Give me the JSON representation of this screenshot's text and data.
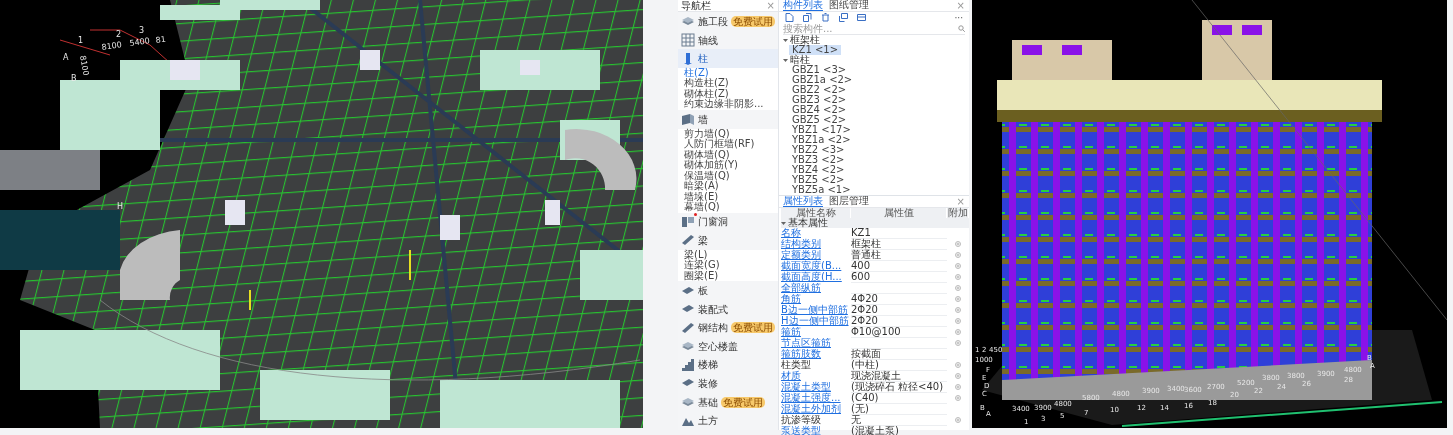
{
  "left_view": {
    "labels": [
      "1",
      "2",
      "3",
      "8100",
      "5400",
      "81",
      "A",
      "B",
      "8100",
      "H"
    ]
  },
  "navigation": {
    "title": "导航栏",
    "close": "×",
    "items": [
      {
        "label": "施工段",
        "kind": "layers",
        "badge": "免费试用",
        "selected": false
      },
      {
        "label": "轴线",
        "kind": "grid",
        "selected": false
      },
      {
        "label": "柱",
        "kind": "column",
        "selected": true,
        "children": [
          {
            "label": "柱(Z)",
            "selected": true
          },
          {
            "label": "构造柱(Z)",
            "selected": false
          },
          {
            "label": "砌体柱(Z)",
            "selected": false
          },
          {
            "label": "约束边缘非阴影...",
            "selected": false
          }
        ]
      },
      {
        "label": "墙",
        "kind": "wall",
        "selected": false,
        "children": [
          {
            "label": "剪力墙(Q)",
            "selected": false
          },
          {
            "label": "人防门框墙(RF)",
            "selected": false
          },
          {
            "label": "砌体墙(Q)",
            "selected": false
          },
          {
            "label": "砌体加筋(Y)",
            "selected": false
          },
          {
            "label": "保温墙(Q)",
            "selected": false
          },
          {
            "label": "暗梁(A)",
            "selected": false
          },
          {
            "label": "墙垛(E)",
            "selected": false
          },
          {
            "label": "幕墙(Q)",
            "selected": false
          }
        ]
      },
      {
        "label": "门窗洞",
        "kind": "door",
        "notification_dot": true,
        "selected": false
      },
      {
        "label": "梁",
        "kind": "beam",
        "selected": false,
        "children": [
          {
            "label": "梁(L)",
            "selected": false
          },
          {
            "label": "连梁(G)",
            "selected": false
          },
          {
            "label": "圈梁(E)",
            "selected": false
          }
        ]
      },
      {
        "label": "板",
        "kind": "slab",
        "selected": false
      },
      {
        "label": "装配式",
        "kind": "slab",
        "selected": false
      },
      {
        "label": "钢结构",
        "kind": "beam",
        "badge": "免费试用",
        "selected": false
      },
      {
        "label": "空心楼盖",
        "kind": "layers",
        "selected": false
      },
      {
        "label": "楼梯",
        "kind": "stairs",
        "selected": false
      },
      {
        "label": "装修",
        "kind": "slab",
        "selected": false
      },
      {
        "label": "基础",
        "kind": "layers",
        "badge": "免费试用",
        "selected": false
      },
      {
        "label": "土方",
        "kind": "earth",
        "selected": false
      }
    ]
  },
  "component_list": {
    "tabs": [
      {
        "label": "构件列表",
        "selected": true
      },
      {
        "label": "图纸管理",
        "selected": false
      }
    ],
    "close": "×",
    "more": "···",
    "search": {
      "placeholder": "搜索构件..."
    },
    "tree": [
      {
        "label": "框架柱",
        "expanded": true,
        "children": [
          {
            "label": "KZ1 <1>",
            "selected": true
          }
        ]
      },
      {
        "label": "暗柱",
        "expanded": true,
        "children": [
          {
            "label": "GBZ1 <3>",
            "selected": false
          },
          {
            "label": "GBZ1a <2>",
            "selected": false
          },
          {
            "label": "GBZ2 <2>",
            "selected": false
          },
          {
            "label": "GBZ3 <2>",
            "selected": false
          },
          {
            "label": "GBZ4 <2>",
            "selected": false
          },
          {
            "label": "GBZ5 <2>",
            "selected": false
          },
          {
            "label": "YBZ1 <17>",
            "selected": false
          },
          {
            "label": "YBZ1a <2>",
            "selected": false
          },
          {
            "label": "YBZ2 <3>",
            "selected": false
          },
          {
            "label": "YBZ3 <2>",
            "selected": false
          },
          {
            "label": "YBZ4 <2>",
            "selected": false
          },
          {
            "label": "YBZ5 <2>",
            "selected": false
          },
          {
            "label": "YBZ5a <1>",
            "selected": false
          }
        ]
      }
    ]
  },
  "properties": {
    "tabs": [
      {
        "label": "属性列表",
        "selected": true
      },
      {
        "label": "图层管理",
        "selected": false
      }
    ],
    "close": "×",
    "columns": [
      "属性名称",
      "属性值",
      "附加"
    ],
    "group": "基本属性",
    "rows": [
      {
        "name": "名称",
        "value": "KZ1",
        "kind": "common",
        "add_icon": false
      },
      {
        "name": "结构类别",
        "value": "框架柱",
        "kind": "common",
        "add_icon": true
      },
      {
        "name": "定额类别",
        "value": "普通柱",
        "kind": "common",
        "add_icon": true
      },
      {
        "name": "截面宽度(B...",
        "value": "400",
        "kind": "common",
        "add_icon": true
      },
      {
        "name": "截面高度(H...",
        "value": "600",
        "kind": "common",
        "add_icon": true
      },
      {
        "name": "全部纵筋",
        "kind": "common",
        "add_icon": true
      },
      {
        "name": "角筋",
        "value": "4Φ20",
        "kind": "common",
        "add_icon": true
      },
      {
        "name": "B边一侧中部筋",
        "value": "2Φ20",
        "kind": "common",
        "add_icon": true
      },
      {
        "name": "H边一侧中部筋",
        "value": "2Φ20",
        "kind": "common",
        "add_icon": true
      },
      {
        "name": "箍筋",
        "value": "Φ10@100",
        "kind": "common",
        "add_icon": true
      },
      {
        "name": "节点区箍筋",
        "kind": "common",
        "add_icon": true
      },
      {
        "name": "箍筋肢数",
        "value": "按截面",
        "kind": "common",
        "add_icon": false
      },
      {
        "name": "柱类型",
        "value": "(中柱)",
        "kind": "plain",
        "add_icon": true
      },
      {
        "name": "材质",
        "value": "现浇混凝土",
        "kind": "common",
        "add_icon": true
      },
      {
        "name": "混凝土类型",
        "value": "(现浇碎石 粒径<40)",
        "kind": "common",
        "add_icon": true
      },
      {
        "name": "混凝土强度...",
        "value": "(C40)",
        "kind": "common",
        "add_icon": true
      },
      {
        "name": "混凝土外加剂",
        "value": "(无)",
        "kind": "common",
        "add_icon": false
      },
      {
        "name": "抗渗等级",
        "value": "无",
        "kind": "plain",
        "add_icon": true
      },
      {
        "name": "泵送类型",
        "value": "(混凝土泵)",
        "kind": "common",
        "add_icon": false
      }
    ]
  },
  "right_view": {
    "labels": [
      "1",
      "2",
      "1000",
      "450",
      "F",
      "E",
      "D",
      "C",
      "B",
      "A",
      "3400",
      "3900",
      "4800",
      "5800",
      "4800",
      "3900",
      "3400",
      "3600",
      "2700",
      "5200",
      "3800",
      "3800",
      "3900",
      "4800",
      "1",
      "3",
      "5",
      "7",
      "10",
      "12",
      "14",
      "16",
      "18",
      "20",
      "22",
      "24",
      "26",
      "28",
      "B",
      "A"
    ]
  }
}
